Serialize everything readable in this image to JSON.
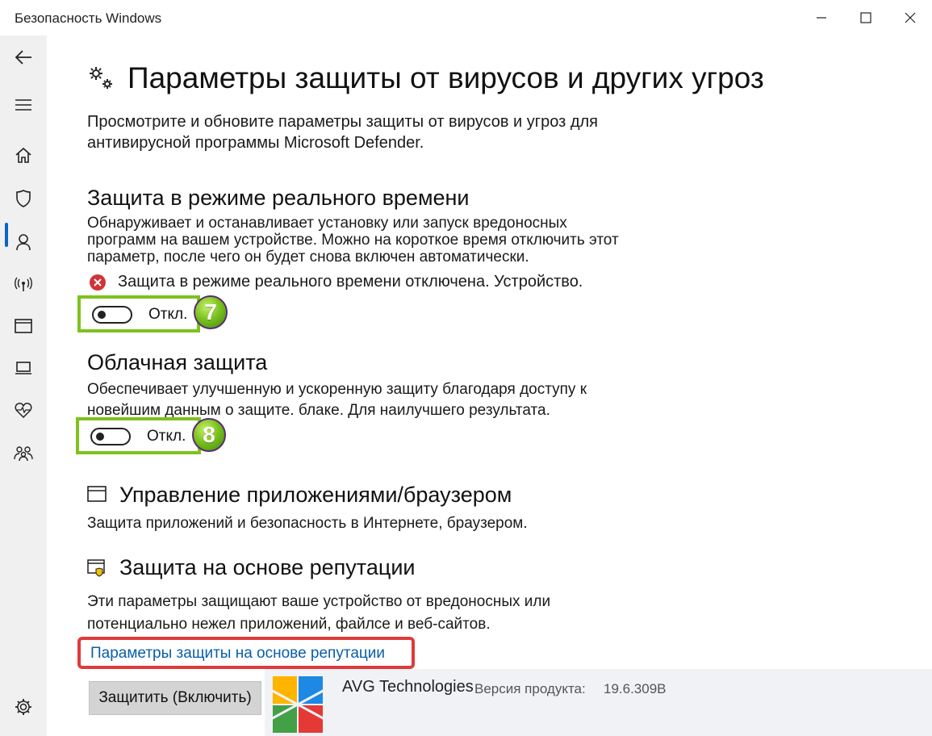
{
  "window": {
    "title": "Безопасность Windows",
    "controls": [
      "minimize-icon",
      "maximize-icon",
      "close-icon"
    ]
  },
  "sidebar": {
    "items": [
      {
        "icon": "back-arrow-icon"
      },
      {
        "icon": "hamburger-menu-icon"
      },
      {
        "icon": "home-icon"
      },
      {
        "icon": "shield-icon",
        "active": true
      },
      {
        "icon": "person-icon"
      },
      {
        "icon": "wireless-icon"
      },
      {
        "icon": "app-browser-icon"
      },
      {
        "icon": "laptop-icon"
      },
      {
        "icon": "heart-pulse-icon"
      },
      {
        "icon": "family-icon"
      },
      {
        "icon": "gear-icon"
      }
    ],
    "active_color": "#0a64c8"
  },
  "page": {
    "title": "Параметры защиты от вирусов и других угроз",
    "title_icon": "gears-icon",
    "description": [
      "Просмотрите и обновите параметры защиты от вирусов и угроз для",
      "антивирусной программы Microsoft Defender."
    ]
  },
  "realtime": {
    "title": "Защита в режиме реального времени",
    "description": [
      "Обнаруживает и останавливает установку или запуск вредоносных",
      "программ на вашем устройстве. Можно на короткое время отключить этот",
      "параметр, после чего он будет снова включен автоматически."
    ],
    "status_icon": "error-icon",
    "status_color": "#d13438",
    "status": "Защита в режиме реального времени отключена. Устройство.",
    "toggle_state": "Откл.",
    "step_badge": "7"
  },
  "cloud": {
    "title": "Облачная защита",
    "description": [
      "Обеспечивает улучшенную и ускоренную защиту благодаря доступу к",
      "новейшим данным о защите. блаке. Для наилучшего результата."
    ],
    "toggle_state": "Откл.",
    "step_badge": "8"
  },
  "app_browser": {
    "icon": "app-browser-icon",
    "title": "Управление приложениями/браузером",
    "description": "Защита приложений и безопасность в Интернете, браузером."
  },
  "reputation": {
    "icon": "reputation-shield-icon",
    "title": "Защита на основе репутации",
    "description": [
      "Эти параметры защищают ваше устройство от вредоносных или",
      "потенциально нежел приложений, файлсе и веб-сайтов."
    ],
    "link": "Параметры защиты на основе репутации"
  },
  "bottom": {
    "button": "Защитить (Включить)",
    "logo": "avg-logo",
    "vendor": "AVG Technologies",
    "version_label": "Версия продукта:",
    "version": "19.6.309B"
  },
  "colors": {
    "highlight_green": "#7dc21e",
    "highlight_red": "#e03a3a",
    "link": "#0a5ea8"
  }
}
